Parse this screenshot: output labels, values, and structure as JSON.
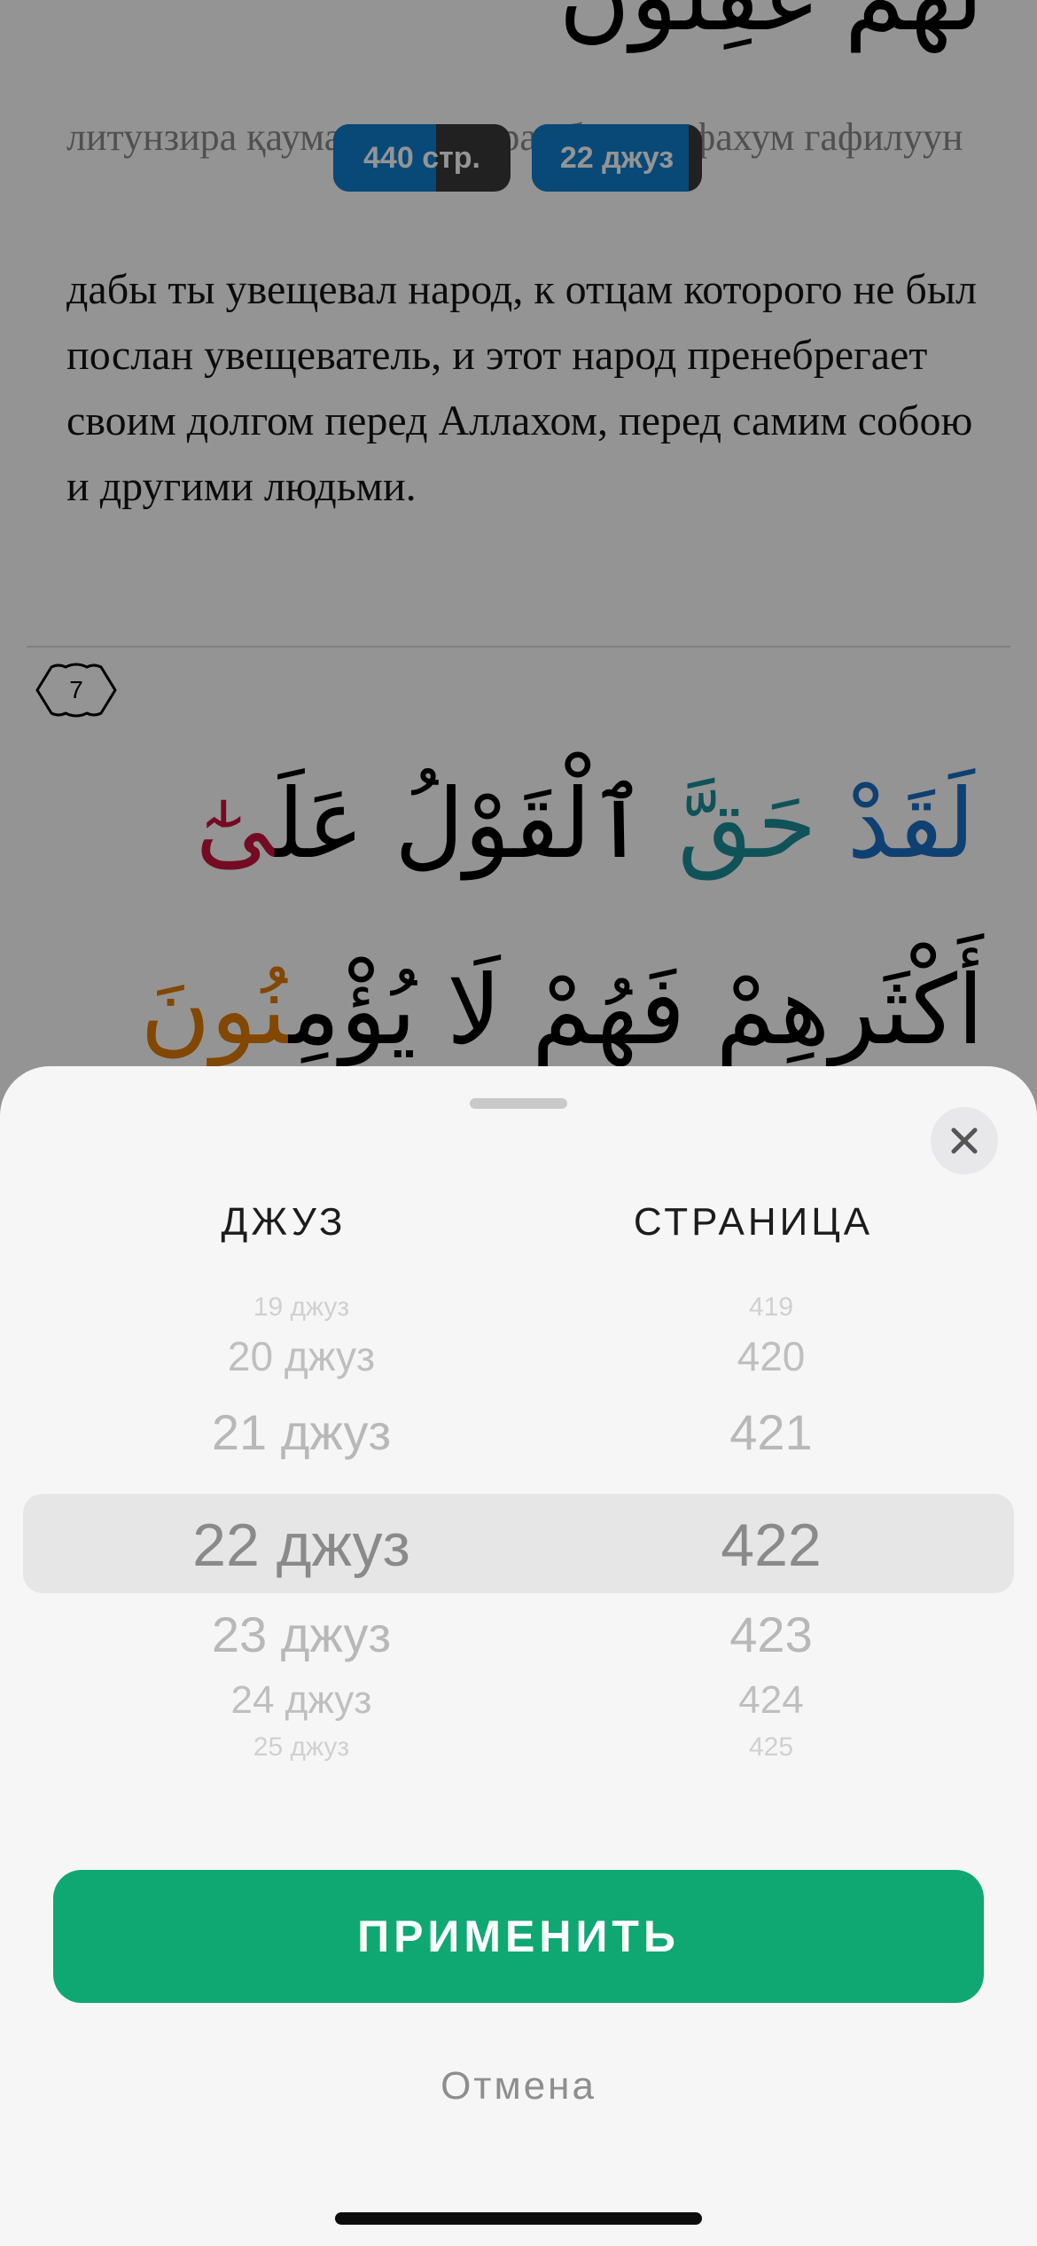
{
  "reader": {
    "arabic_top": "لَهُمْ غَفِلُونَ",
    "transliteration": "литунзира қауман ма унзира абаухум фахум гафилуун",
    "progress_pills": {
      "pages": {
        "label": "440 стр.",
        "progress": 0.58
      },
      "juz": {
        "label": "22 джуз",
        "progress": 0.92
      }
    },
    "translation": "дабы ты увещевал народ, к отцам которого не был послан увещеватель, и этот народ пренебрегает своим долгом перед Аллахом, перед самим собою и другими людьми.",
    "ayah_number": "7",
    "arabic_line1": {
      "part_a": "لَقَدْ",
      "part_b": "حَقَّ",
      "part_c": "ٱلْقَوْلُ عَلَ",
      "part_d": "ىٰٓ"
    },
    "arabic_line2": {
      "part_a": "أَكْثَرِهِمْ فَهُمْ لَا يُؤْمِ",
      "part_b": "نُونَ"
    }
  },
  "sheet": {
    "headers": {
      "juz": "ДЖУЗ",
      "page": "СТРАНИЦА"
    },
    "juz_options": [
      "19 джуз",
      "20 джуз",
      "21 джуз",
      "22 джуз",
      "23 джуз",
      "24 джуз",
      "25 джуз"
    ],
    "page_options": [
      "419",
      "420",
      "421",
      "422",
      "423",
      "424",
      "425"
    ],
    "selected_index": 3,
    "apply_label": "ПРИМЕНИТЬ",
    "cancel_label": "Отмена"
  },
  "colors": {
    "accent_green": "#0fa873",
    "progress_blue": "#0e7fcf",
    "tajweed_blue": "#1a6fc4",
    "tajweed_orange": "#e07b00",
    "tajweed_red": "#c8143c"
  },
  "icons": {
    "close": "close-icon",
    "ayah_marker": "ayah-marker-icon"
  }
}
